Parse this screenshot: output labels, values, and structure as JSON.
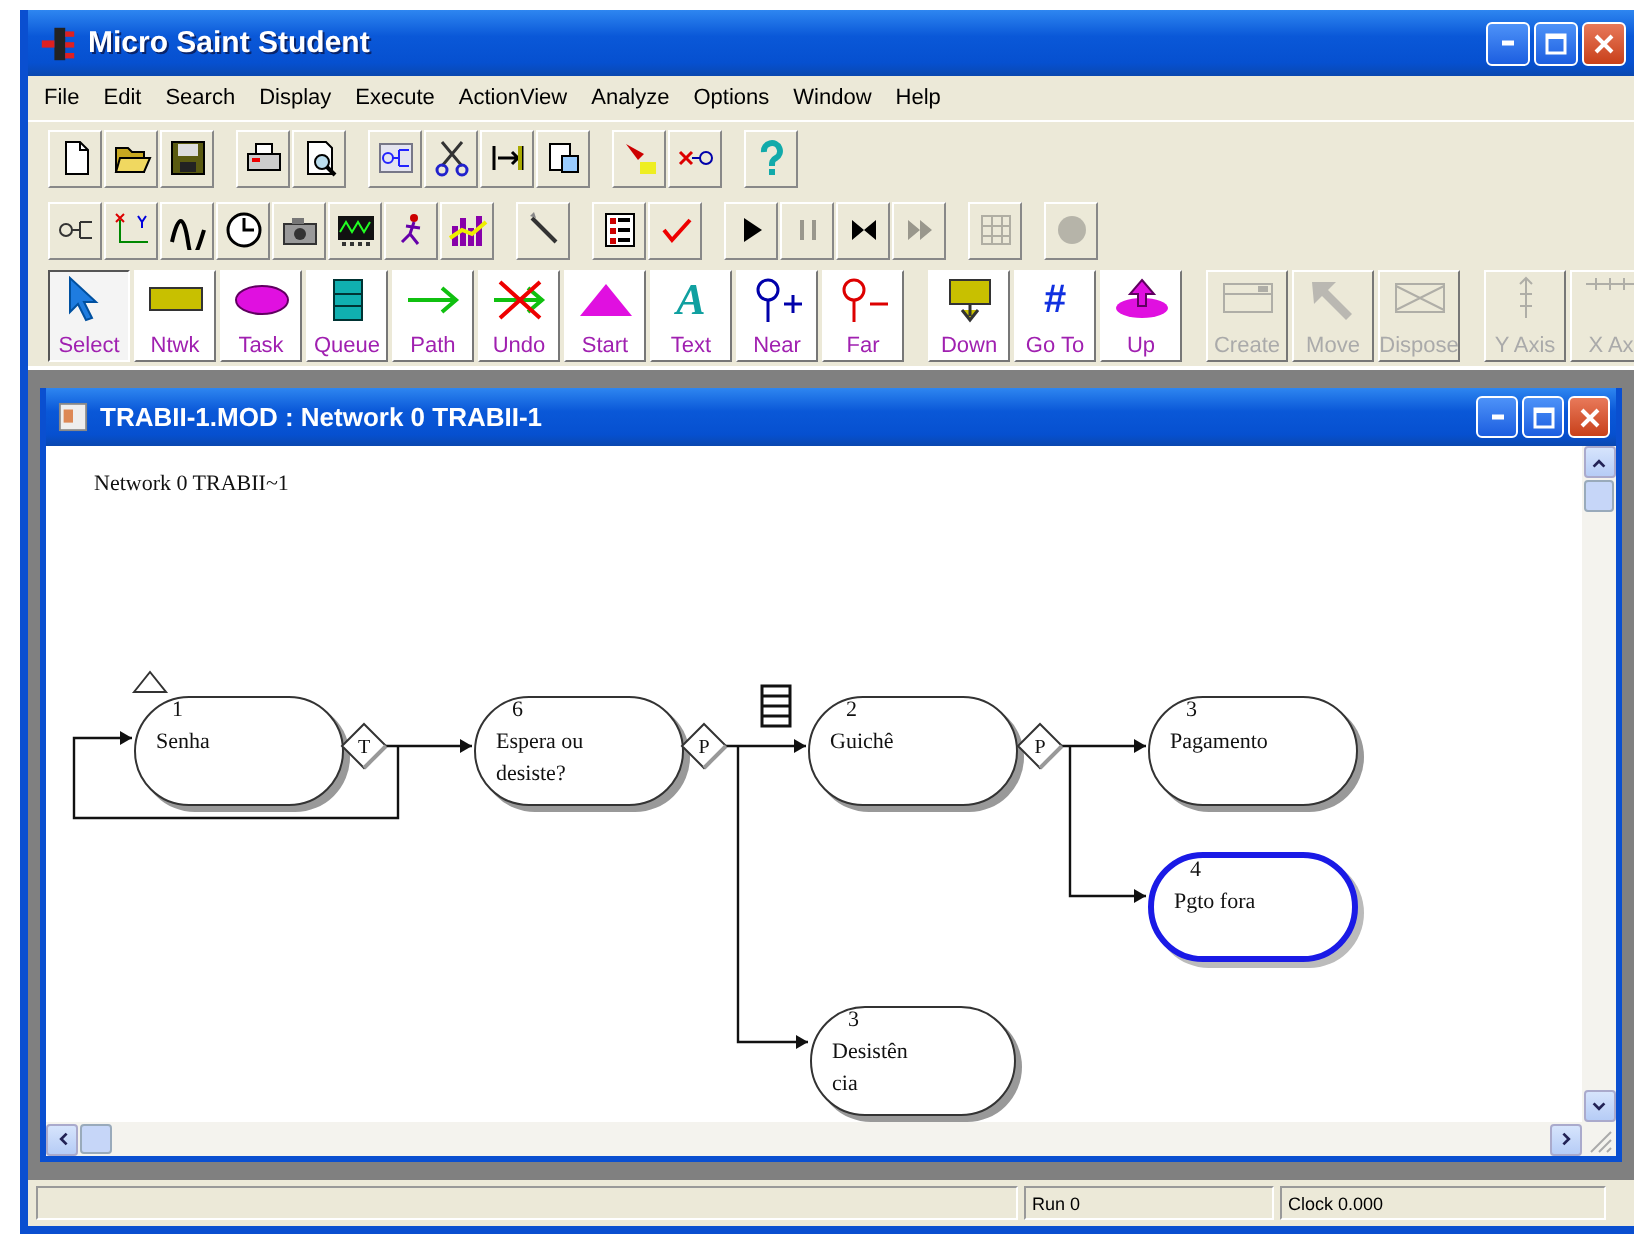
{
  "window": {
    "title": "Micro Saint Student"
  },
  "menu": [
    "File",
    "Edit",
    "Search",
    "Display",
    "Execute",
    "ActionView",
    "Analyze",
    "Options",
    "Window",
    "Help"
  ],
  "toolbar_2": [
    {
      "disabled": false
    },
    {
      "disabled": false
    },
    {
      "disabled": false
    },
    {
      "disabled": false
    },
    {
      "disabled": false
    },
    {
      "disabled": false
    },
    {
      "disabled": false
    },
    {
      "disabled": false
    },
    {
      "disabled": false
    },
    {
      "disabled": false
    },
    {
      "disabled": false
    },
    {
      "disabled": false
    },
    {
      "disabled": true
    },
    {
      "disabled": false
    },
    {
      "disabled": true
    },
    {
      "disabled": true
    },
    {
      "disabled": true
    }
  ],
  "tool_palette": [
    {
      "label": "Select",
      "selected": true,
      "disabled": false
    },
    {
      "label": "Ntwk",
      "selected": false,
      "disabled": false
    },
    {
      "label": "Task",
      "selected": false,
      "disabled": false
    },
    {
      "label": "Queue",
      "selected": false,
      "disabled": false
    },
    {
      "label": "Path",
      "selected": false,
      "disabled": false
    },
    {
      "label": "Undo",
      "selected": false,
      "disabled": false
    },
    {
      "label": "Start",
      "selected": false,
      "disabled": false
    },
    {
      "label": "Text",
      "glyph": "A",
      "selected": false,
      "disabled": false
    },
    {
      "label": "Near",
      "selected": false,
      "disabled": false
    },
    {
      "label": "Far",
      "selected": false,
      "disabled": false
    },
    {
      "label": "Down",
      "selected": false,
      "disabled": false
    },
    {
      "label": "Go To",
      "glyph": "#",
      "selected": false,
      "disabled": false
    },
    {
      "label": "Up",
      "selected": false,
      "disabled": false
    },
    {
      "label": "Create",
      "selected": false,
      "disabled": true
    },
    {
      "label": "Move",
      "selected": false,
      "disabled": true
    },
    {
      "label": "Dispose",
      "selected": false,
      "disabled": true
    },
    {
      "label": "Y Axis",
      "selected": false,
      "disabled": true
    },
    {
      "label": "X Ax",
      "selected": false,
      "disabled": true
    }
  ],
  "document": {
    "title": "TRABII-1.MOD : Network 0 TRABII-1",
    "network_label": "Network 0 TRABII~1",
    "tasks": [
      {
        "number": "1",
        "name": "Senha",
        "selected": false
      },
      {
        "number": "6",
        "name": "Espera ou desiste?",
        "selected": false
      },
      {
        "number": "2",
        "name": "Guichê",
        "selected": false
      },
      {
        "number": "3",
        "name": "Pagamento",
        "selected": false
      },
      {
        "number": "4",
        "name": "Pgto fora",
        "selected": true
      },
      {
        "number": "3",
        "name": "Desistência",
        "selected": false
      }
    ],
    "decisions": [
      {
        "label": "T"
      },
      {
        "label": "P"
      },
      {
        "label": "P"
      }
    ]
  },
  "status_bar": {
    "run": "Run 0",
    "clock": "Clock 0.000"
  }
}
